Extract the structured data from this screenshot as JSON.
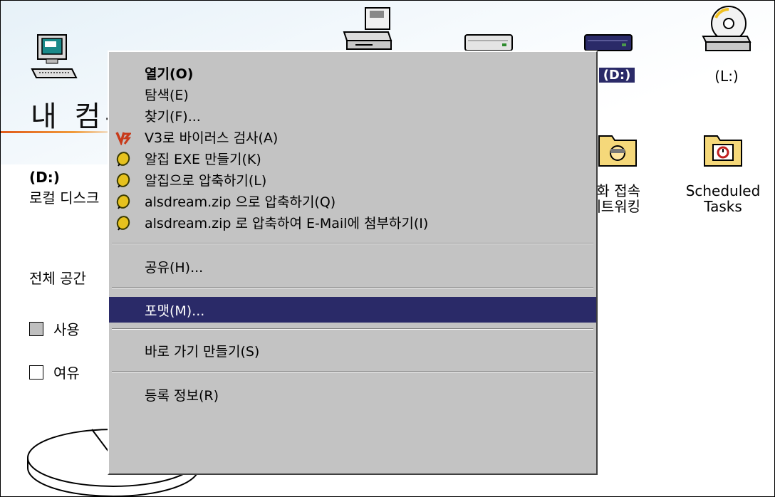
{
  "window": {
    "title": "내 컴퓨터"
  },
  "drive_info": {
    "drive_letter": "(D:)",
    "drive_type": "로컬 디스크",
    "total_space_label": "전체 공간",
    "used_label": "사용",
    "free_label": "여유",
    "colors": {
      "used": "#bfbfbf",
      "free": "#ffffff",
      "accent_rule": "#e05a1a"
    }
  },
  "icons": [
    {
      "name": "floppy-drive",
      "label": ""
    },
    {
      "name": "hard-drive-c",
      "label": ""
    },
    {
      "name": "hard-drive-d",
      "label": "(D:)"
    },
    {
      "name": "cd-rom-drive",
      "label": "(L:)"
    },
    {
      "name": "dial-up-networking",
      "label": "전화 접속\n네트워킹"
    },
    {
      "name": "scheduled-tasks",
      "label": "Scheduled\nTasks"
    }
  ],
  "context_menu": {
    "items": [
      {
        "label": "열기(O)",
        "bold": true,
        "icon": ""
      },
      {
        "label": "탐색(E)",
        "icon": ""
      },
      {
        "label": "찾기(F)...",
        "icon": ""
      },
      {
        "label": "V3로 바이러스 검사(A)",
        "icon": "v3-icon"
      },
      {
        "label": "알집 EXE 만들기(K)",
        "icon": "alzip-icon"
      },
      {
        "label": "알집으로 압축하기(L)",
        "icon": "alzip-icon"
      },
      {
        "label": "alsdream.zip 으로 압축하기(Q)",
        "icon": "alzip-icon"
      },
      {
        "label": "alsdream.zip 로 압축하여 E-Mail에 첨부하기(I)",
        "icon": "alzip-icon"
      },
      {
        "label": "공유(H)...",
        "icon": ""
      },
      {
        "label": "포맷(M)...",
        "selected": true,
        "icon": ""
      },
      {
        "label": "바로 가기 만들기(S)",
        "icon": ""
      },
      {
        "label": "등록 정보(R)",
        "icon": ""
      }
    ],
    "colors": {
      "background": "#c3c3c3",
      "highlight": "#2a2a68",
      "highlight_text": "#ffffff"
    }
  }
}
